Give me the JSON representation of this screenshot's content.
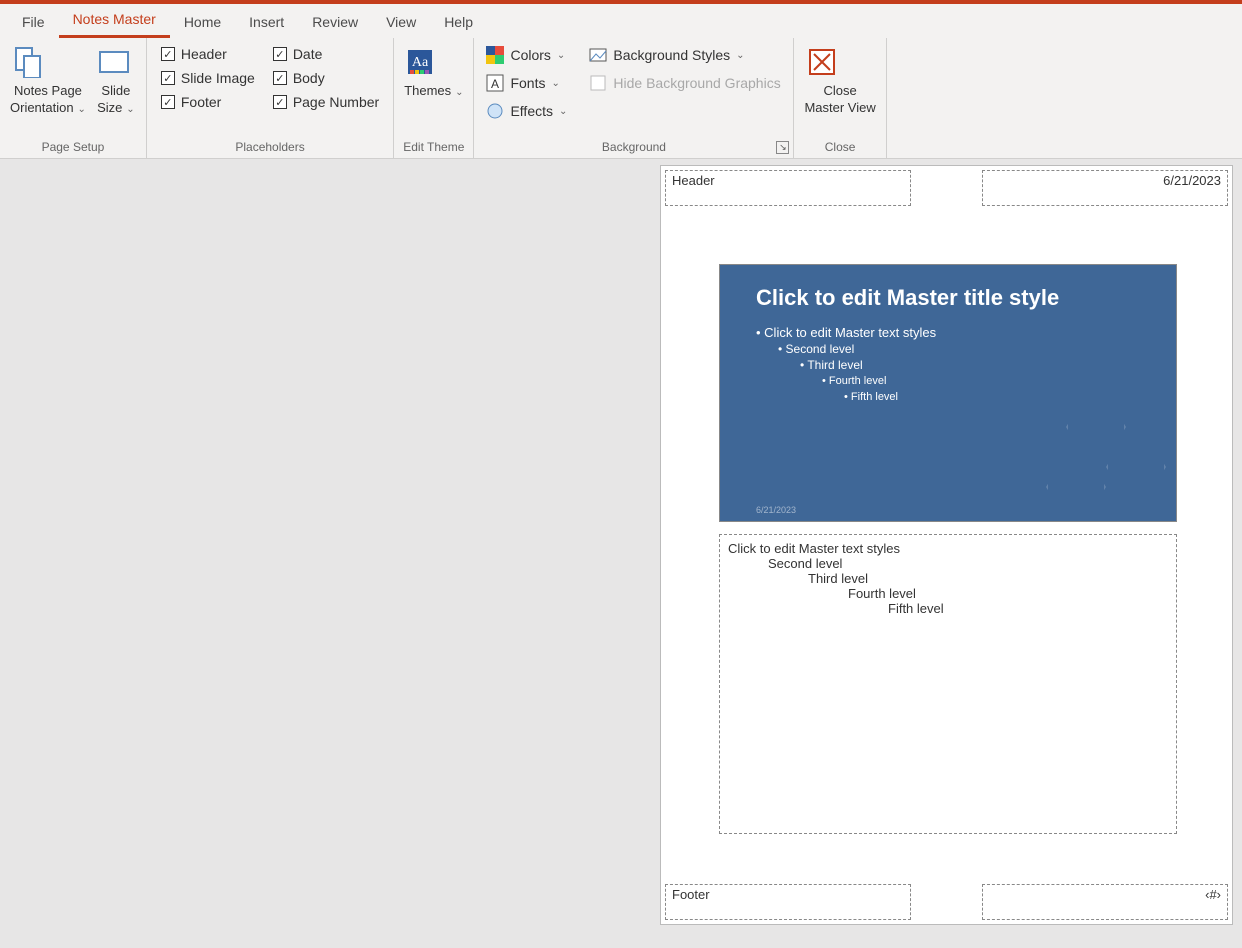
{
  "tabs": {
    "file": "File",
    "notes_master": "Notes Master",
    "home": "Home",
    "insert": "Insert",
    "review": "Review",
    "view": "View",
    "help": "Help"
  },
  "page_setup": {
    "orientation": "Notes Page\nOrientation",
    "slide_size": "Slide\nSize",
    "group_label": "Page Setup"
  },
  "placeholders": {
    "header": "Header",
    "slide_image": "Slide Image",
    "footer": "Footer",
    "date": "Date",
    "body": "Body",
    "page_number": "Page Number",
    "group_label": "Placeholders",
    "checked": {
      "header": true,
      "slide_image": true,
      "footer": true,
      "date": true,
      "body": true,
      "page_number": true
    }
  },
  "edit_theme": {
    "themes": "Themes",
    "group_label": "Edit Theme"
  },
  "background": {
    "colors": "Colors",
    "fonts": "Fonts",
    "effects": "Effects",
    "bg_styles": "Background Styles",
    "hide_bg": "Hide Background Graphics",
    "group_label": "Background"
  },
  "close": {
    "close_master": "Close\nMaster View",
    "group_label": "Close"
  },
  "page": {
    "header": "Header",
    "date": "6/21/2023",
    "footer": "Footer",
    "page_number": "‹#›"
  },
  "slide": {
    "title": "Click to edit Master title style",
    "levels": {
      "l0": "Click to edit Master text styles",
      "l1": "Second level",
      "l2": "Third level",
      "l3": "Fourth level",
      "l4": "Fifth level"
    },
    "date_stamp": "6/21/2023"
  },
  "notes": {
    "l0": "Click to edit Master text styles",
    "l1": "Second level",
    "l2": "Third level",
    "l3": "Fourth level",
    "l4": "Fifth level"
  },
  "colors": {
    "accent": "#c43e1c",
    "slide_bg": "#3f6797"
  }
}
